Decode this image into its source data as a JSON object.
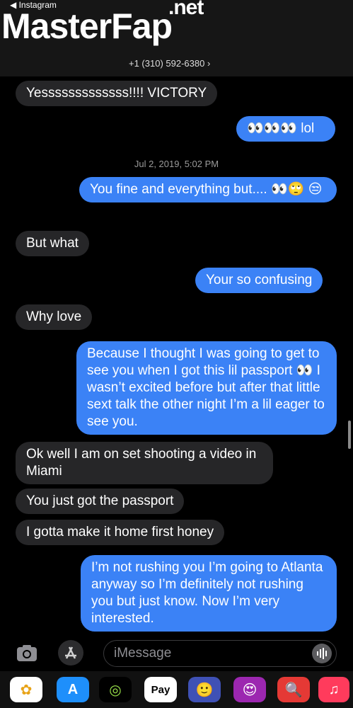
{
  "header": {
    "back_label": "◀ Instagram",
    "watermark_main": "MasterFap",
    "watermark_suffix": ".net",
    "contact_phone": "+1 (310) 592-6380"
  },
  "messages": [
    {
      "dir": "in",
      "text": "Yesssssssssssss!!!! VICTORY"
    },
    {
      "dir": "out",
      "text": "👀👀👀 lol"
    },
    {
      "timestamp": "Jul 2, 2019, 5:02 PM"
    },
    {
      "dir": "out",
      "text": "You fine and everything but.... 👀🙄 😒"
    },
    {
      "dir": "in",
      "text": "But what"
    },
    {
      "dir": "out",
      "text": "Your so confusing"
    },
    {
      "dir": "in",
      "text": "Why love"
    },
    {
      "dir": "out",
      "text": "Because I thought I was going to get to see you when I got this lil passport 👀 I wasn’t excited before but after that little sext talk the other night I’m a lil eager to see you."
    },
    {
      "dir": "in",
      "text": "Ok well I am on set shooting a video in Miami"
    },
    {
      "dir": "in",
      "text": "You just got the passport"
    },
    {
      "dir": "in",
      "text": "I gotta make it home first honey"
    },
    {
      "dir": "out",
      "text": "I’m not rushing you I’m going to Atlanta anyway so I’m definitely not rushing you but just know. Now I’m very interested."
    }
  ],
  "composer": {
    "placeholder": "iMessage"
  },
  "dock": [
    {
      "name": "photos-app-icon",
      "glyph": "✿",
      "color": "#ffffff",
      "fg": "#e8a317"
    },
    {
      "name": "app-store-icon",
      "glyph": "A",
      "color": "#1e8ffb",
      "fg": "#ffffff"
    },
    {
      "name": "activity-icon",
      "glyph": "◎",
      "color": "#000000",
      "fg": "#9ae34a"
    },
    {
      "name": "apple-pay-icon",
      "glyph": "Pay",
      "color": "#ffffff",
      "fg": "#000000"
    },
    {
      "name": "memoji-icon",
      "glyph": "🙂",
      "color": "#3f51b5",
      "fg": "#ffffff"
    },
    {
      "name": "memoji-stickers-icon",
      "glyph": "😍",
      "color": "#9c27b0",
      "fg": "#ffffff"
    },
    {
      "name": "search-images-icon",
      "glyph": "🔍",
      "color": "#e53935",
      "fg": "#ffffff"
    },
    {
      "name": "music-icon",
      "glyph": "♫",
      "color": "#ff3b5c",
      "fg": "#ffffff"
    }
  ]
}
